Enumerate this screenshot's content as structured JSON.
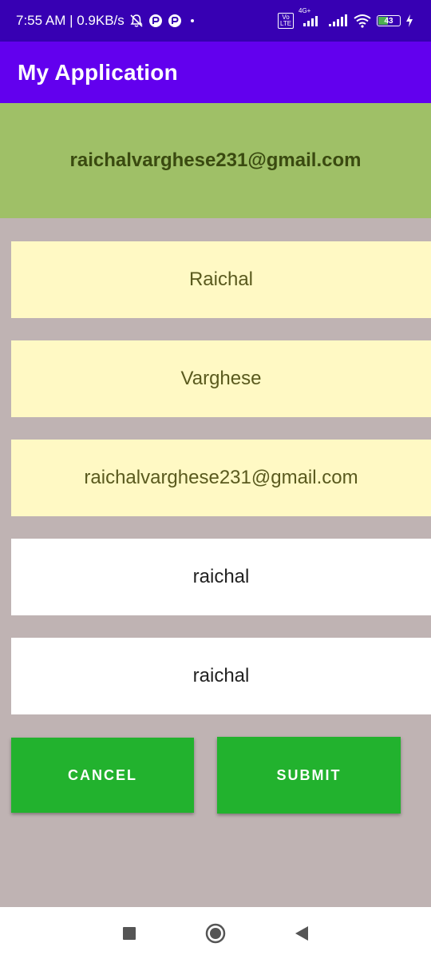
{
  "status_bar": {
    "time_speed": "7:55 AM | 0.9KB/s",
    "volte": "Vo LTE",
    "network": "4G+",
    "battery": "43"
  },
  "app_bar": {
    "title": "My Application"
  },
  "header": {
    "email": "raichalvarghese231@gmail.com"
  },
  "form": {
    "first_name": "Raichal",
    "last_name": "Varghese",
    "email": "raichalvarghese231@gmail.com",
    "password": "raichal",
    "confirm_password": "raichal"
  },
  "buttons": {
    "cancel": "CANCEL",
    "submit": "SUBMIT"
  },
  "colors": {
    "status_bar": "#3700b3",
    "app_bar": "#6200ee",
    "header_bg": "#9fc067",
    "page_bg": "#bfb3b3",
    "field_yellow": "#fff9c4",
    "button_green": "#22b22e"
  }
}
